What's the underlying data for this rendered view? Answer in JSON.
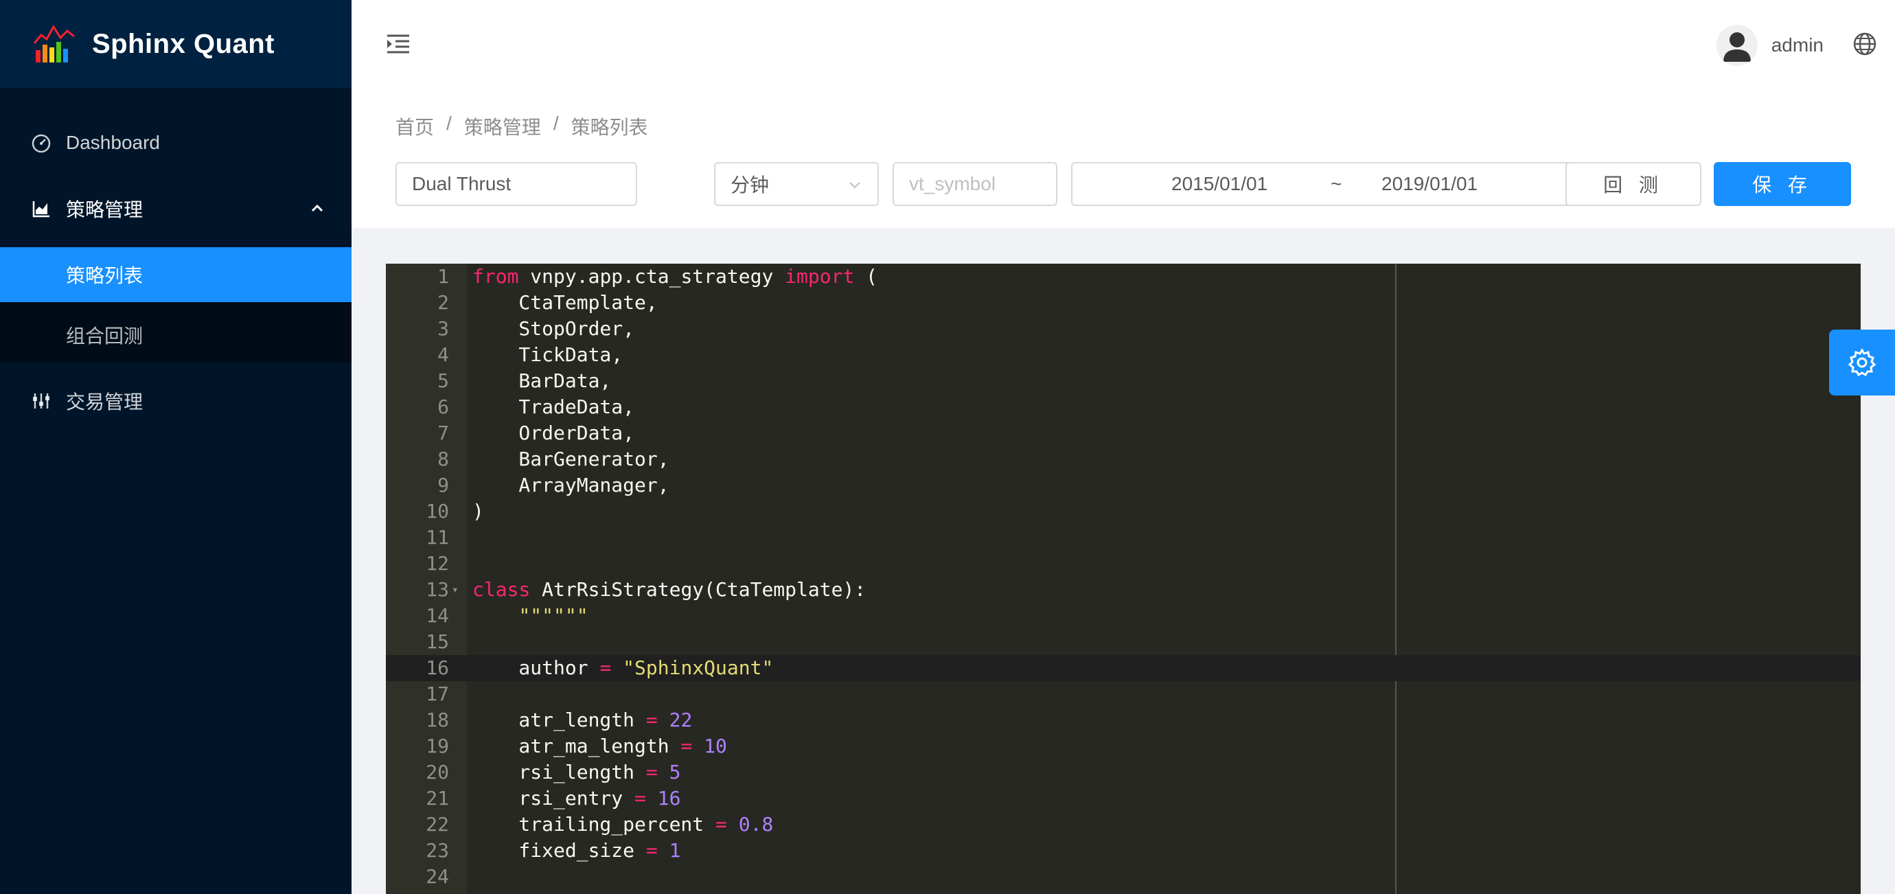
{
  "app": {
    "name": "Sphinx Quant"
  },
  "sidebar": {
    "items": [
      {
        "label": "Dashboard",
        "icon": "dashboard-icon"
      },
      {
        "label": "策略管理",
        "icon": "area-chart-icon",
        "expanded": true,
        "children": [
          {
            "label": "策略列表",
            "active": true
          },
          {
            "label": "组合回测",
            "active": false
          }
        ]
      },
      {
        "label": "交易管理",
        "icon": "sliders-icon"
      }
    ]
  },
  "header": {
    "username": "admin"
  },
  "breadcrumb": [
    "首页",
    "策略管理",
    "策略列表"
  ],
  "breadcrumb_separator": "/",
  "form": {
    "strategy_name": "Dual Thrust",
    "interval": "分钟",
    "symbol_placeholder": "vt_symbol",
    "start_date": "2015/01/01",
    "range_separator": "~",
    "end_date": "2019/01/01",
    "backtest_label": "回 测",
    "save_label": "保 存"
  },
  "colors": {
    "primary": "#1890ff",
    "sidebar_bg": "#001529",
    "editor_bg": "#272822",
    "keyword": "#f92672",
    "string": "#e6db74",
    "number": "#ae81ff"
  },
  "editor": {
    "active_line": 16,
    "lines": [
      "from vnpy.app.cta_strategy import (",
      "    CtaTemplate,",
      "    StopOrder,",
      "    TickData,",
      "    BarData,",
      "    TradeData,",
      "    OrderData,",
      "    BarGenerator,",
      "    ArrayManager,",
      ")",
      "",
      "",
      "class AtrRsiStrategy(CtaTemplate):",
      "    \"\"\"\"\"\"",
      "",
      "    author = \"SphinxQuant\"",
      "",
      "    atr_length = 22",
      "    atr_ma_length = 10",
      "    rsi_length = 5",
      "    rsi_entry = 16",
      "    trailing_percent = 0.8",
      "    fixed_size = 1",
      ""
    ]
  }
}
